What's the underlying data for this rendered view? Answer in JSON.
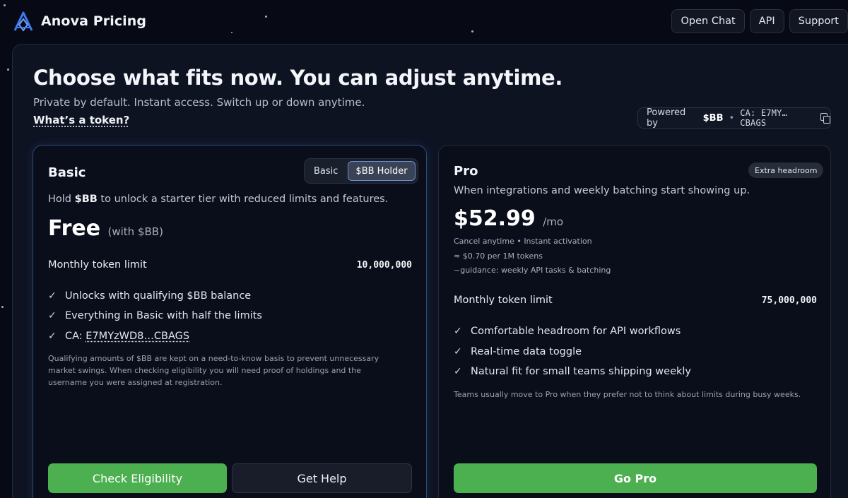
{
  "brand": {
    "name": "Anova Pricing",
    "logo_icon": "a-mountain-logo-icon",
    "accent": "#3d7bf0"
  },
  "nav": {
    "items": [
      "Open Chat",
      "API",
      "Support"
    ]
  },
  "hero": {
    "title": "Choose what fits now. You can adjust anytime.",
    "subtitle": "Private by default. Instant access. Switch up or down anytime.",
    "token_link": "What’s a token?"
  },
  "powered": {
    "prefix": "Powered by",
    "token": "$BB",
    "separator": "•",
    "ca": "CA: E7MY…CBAGS",
    "copy_icon": "copy-icon"
  },
  "basic": {
    "title": "Basic",
    "toggle": [
      "Basic",
      "$BB Holder"
    ],
    "toggle_selected": "$BB Holder",
    "desc_pre": "Hold ",
    "desc_token": "$BB",
    "desc_post": " to unlock a starter tier with reduced limits and features.",
    "price": "Free",
    "price_note": "(with $BB)",
    "limit_label": "Monthly token limit",
    "limit_value": "10,000,000",
    "features": [
      "Unlocks with qualifying $BB balance",
      "Everything in Basic with half the limits"
    ],
    "ca_label": "CA: ",
    "ca_value": "E7MYzWD8…CBAGS",
    "note": "Qualifying amounts of $BB are kept on a need-to-know basis to prevent unnecessary market swings. When checking eligibility you will need proof of holdings and the username you were assigned at registration.",
    "primary_button": "Check Eligibility",
    "secondary_button": "Get Help"
  },
  "pro": {
    "title": "Pro",
    "badge": "Extra headroom",
    "desc": "When integrations and weekly batching start showing up.",
    "price": "$52.99",
    "price_unit": "/mo",
    "meta": [
      "Cancel anytime • Instant activation",
      "≈ $0.70 per 1M tokens",
      "~guidance: weekly API tasks & batching"
    ],
    "limit_label": "Monthly token limit",
    "limit_value": "75,000,000",
    "features": [
      "Comfortable headroom for API workflows",
      "Real-time data toggle",
      "Natural fit for small teams shipping weekly"
    ],
    "note": "Teams usually move to Pro when they prefer not to think about limits during busy weeks.",
    "button": "Go Pro"
  },
  "colors": {
    "green": "#4caf50",
    "panel": "#0e1322",
    "background": "#070a14"
  }
}
